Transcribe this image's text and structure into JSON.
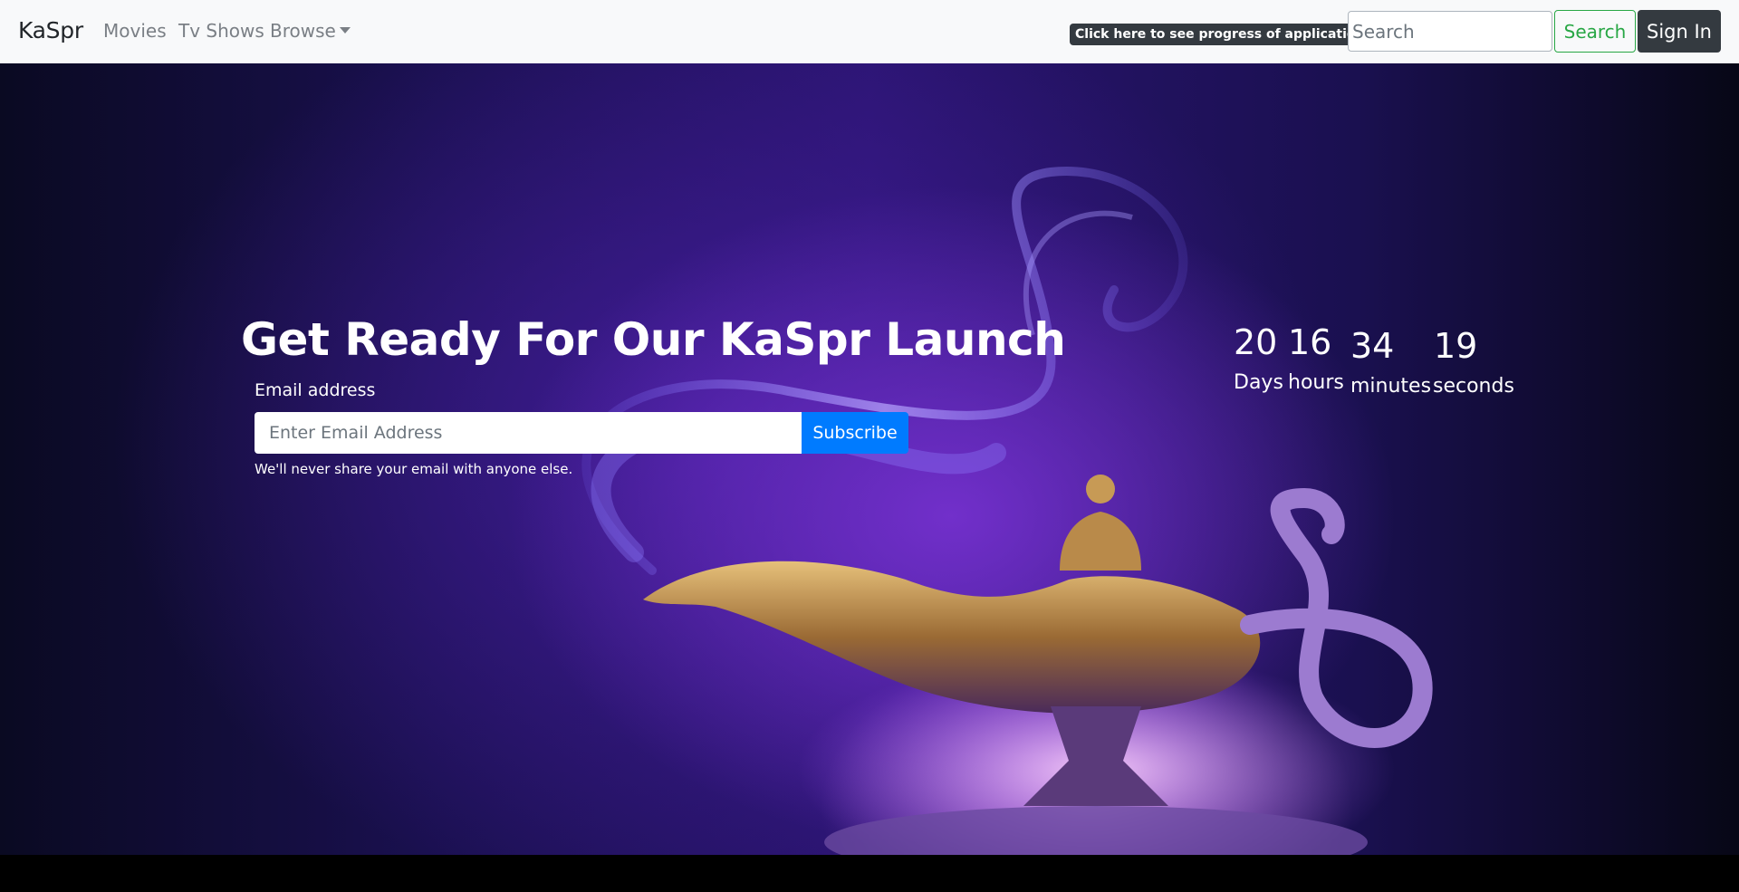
{
  "nav": {
    "brand": "KaSpr",
    "items": [
      "Movies",
      "Tv Shows",
      "Browse"
    ],
    "progress_badge": "Click here to see progress of application",
    "search_placeholder": "Search",
    "search_button": "Search",
    "signin_button": "Sign In"
  },
  "hero": {
    "headline": "Get Ready For Our KaSpr Launch",
    "email_label": "Email address",
    "email_placeholder": "Enter Email Address",
    "subscribe_button": "Subscribe",
    "help_text": "We'll never share your email with anyone else."
  },
  "countdown": {
    "days": "20",
    "days_label": "Days",
    "hours": "16",
    "hours_label": "hours",
    "minutes": "34",
    "minutes_label": "minutes",
    "seconds": "19",
    "seconds_label": "seconds"
  },
  "colors": {
    "navbar_bg": "#f8f9fa",
    "subscribe": "#007bff",
    "search_outline": "#28a745",
    "dark_button": "#343a40"
  }
}
